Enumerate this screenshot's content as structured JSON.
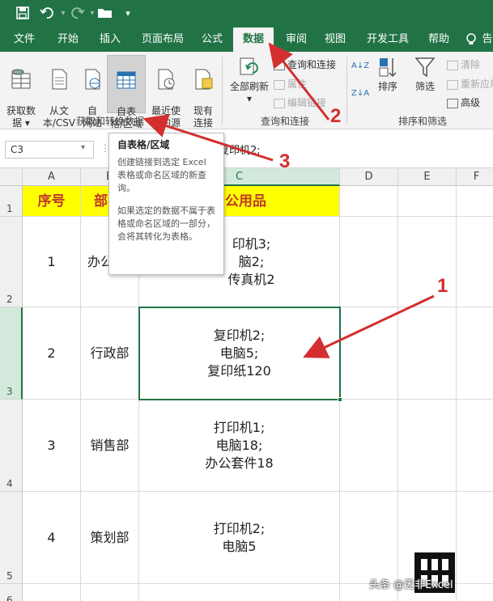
{
  "quick_access": {
    "save_icon": "save-icon",
    "undo_icon": "undo-icon",
    "redo_icon": "redo-icon",
    "open_icon": "folder-open-icon",
    "customize_icon": "chevron-down-icon"
  },
  "tabs": [
    {
      "label": "文件"
    },
    {
      "label": "开始"
    },
    {
      "label": "插入"
    },
    {
      "label": "页面布局"
    },
    {
      "label": "公式"
    },
    {
      "label": "数据"
    },
    {
      "label": "审阅"
    },
    {
      "label": "视图"
    },
    {
      "label": "开发工具"
    },
    {
      "label": "帮助"
    },
    {
      "label": "告"
    }
  ],
  "ribbon": {
    "get_data": "获取数\n据 ▾",
    "from_text_csv": "从文\n本/CSV",
    "from_web": "自\n网站",
    "from_table": "自表\n格/区域",
    "recent_sources": "最近使\n用的源",
    "existing_connections": "现有\n连接",
    "group_get_transform": "获取和转换数据",
    "refresh_all": "全部刷新",
    "refresh_all_arrow": "▾",
    "queries_connections": "查询和连接",
    "properties": "属性",
    "edit_links": "编辑链接",
    "group_queries": "查询和连接",
    "sort_az": "A↓Z",
    "sort_za": "Z↓A",
    "sort": "排序",
    "filter": "筛选",
    "clear": "清除",
    "reapply": "重新应用",
    "advanced": "高级",
    "group_sort_filter": "排序和筛选"
  },
  "formula_bar": {
    "name_box": "C3",
    "formula_visible": "复印机2;"
  },
  "columns": [
    "A",
    "B",
    "C",
    "D",
    "E",
    "F"
  ],
  "rows": [
    "1",
    "2",
    "3",
    "4",
    "5",
    "6"
  ],
  "table": {
    "header": {
      "a": "序号",
      "b": "部",
      "c": "公用品"
    },
    "rows": [
      {
        "a": "1",
        "b": "办公",
        "c": "印机3;\n脑2;\n传真机2"
      },
      {
        "a": "2",
        "b": "行政部",
        "c": "复印机2;\n电脑5;\n复印纸120"
      },
      {
        "a": "3",
        "b": "销售部",
        "c": "打印机1;\n电脑18;\n办公套件18"
      },
      {
        "a": "4",
        "b": "策划部",
        "c": "打印机2;\n电脑5"
      }
    ]
  },
  "tooltip": {
    "title": "自表格/区域",
    "para1": "创建链接到选定 Excel 表格或命名区域的新查询。",
    "para2": "如果选定的数据不属于表格或命名区域的一部分，会将其转化为表格。"
  },
  "annotations": {
    "n1": "1",
    "n2": "2",
    "n3": "3",
    "color": "#d32f2f"
  },
  "watermark": {
    "text": "头条 @无非Excel"
  },
  "colors": {
    "excel_green": "#217346",
    "header_fill": "#ffff00",
    "header_text": "#c0392b"
  }
}
